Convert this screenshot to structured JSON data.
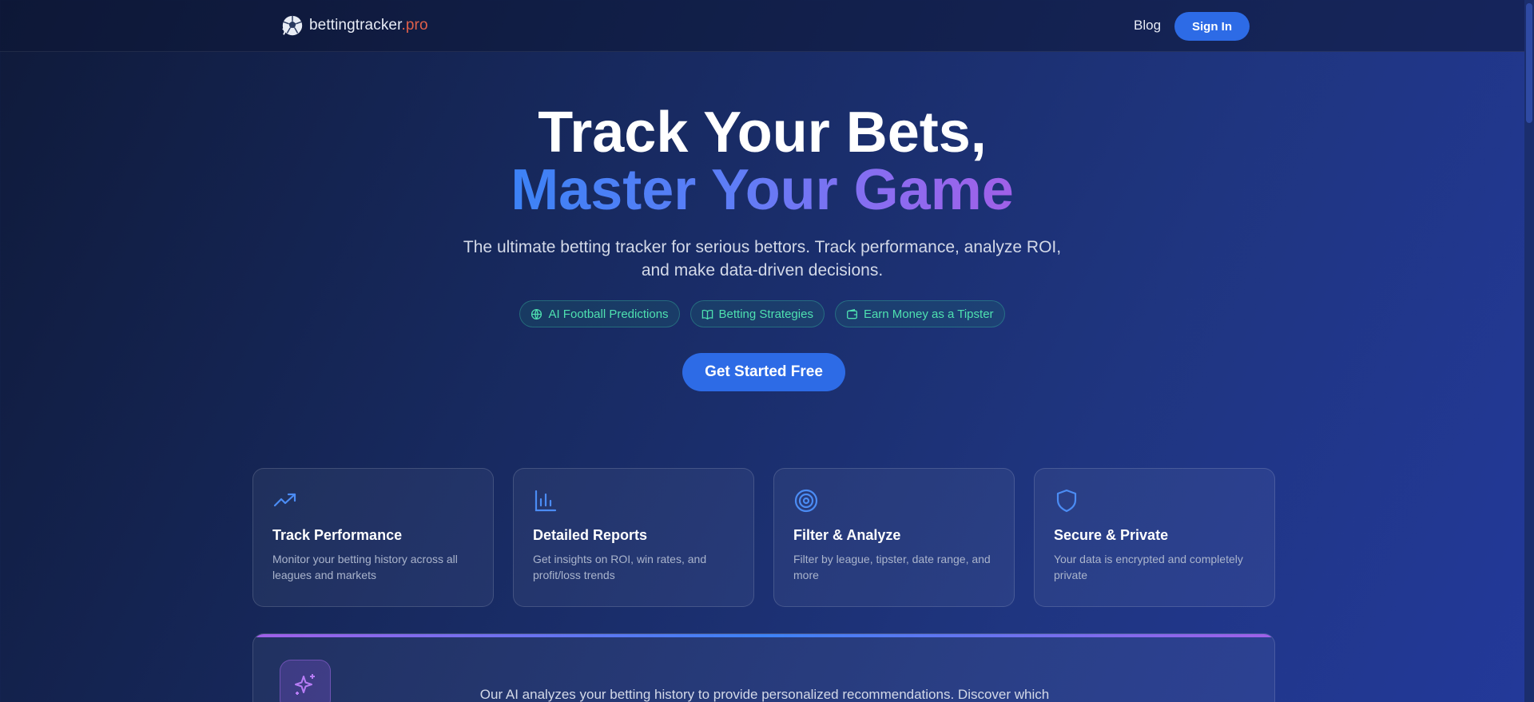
{
  "header": {
    "brand_name": "bettingtracker",
    "brand_tld": ".pro",
    "nav_blog": "Blog",
    "signin_label": "Sign In"
  },
  "hero": {
    "title_line1": "Track Your Bets,",
    "title_line2": "Master Your Game",
    "subtitle_line1": "The ultimate betting tracker for serious bettors. Track performance, analyze ROI,",
    "subtitle_line2": "and make data-driven decisions.",
    "pills": [
      {
        "label": "AI Football Predictions",
        "icon": "globe-icon"
      },
      {
        "label": "Betting Strategies",
        "icon": "book-icon"
      },
      {
        "label": "Earn Money as a Tipster",
        "icon": "wallet-icon"
      }
    ],
    "cta_label": "Get Started Free"
  },
  "features": [
    {
      "icon": "trending-up-icon",
      "title": "Track Performance",
      "desc": "Monitor your betting history across all leagues and markets"
    },
    {
      "icon": "bar-chart-icon",
      "title": "Detailed Reports",
      "desc": "Get insights on ROI, win rates, and profit/loss trends"
    },
    {
      "icon": "target-icon",
      "title": "Filter & Analyze",
      "desc": "Filter by league, tipster, date range, and more"
    },
    {
      "icon": "shield-icon",
      "title": "Secure & Private",
      "desc": "Your data is encrypted and completely private"
    }
  ],
  "ai_section": {
    "icon": "sparkles-icon",
    "text": "Our AI analyzes your betting history to provide personalized recommendations. Discover which"
  },
  "colors": {
    "accent": "#2d6be6",
    "pill_text": "#4ee0b0",
    "feature_icon": "#4b8cf4",
    "tld": "#e0604a"
  }
}
